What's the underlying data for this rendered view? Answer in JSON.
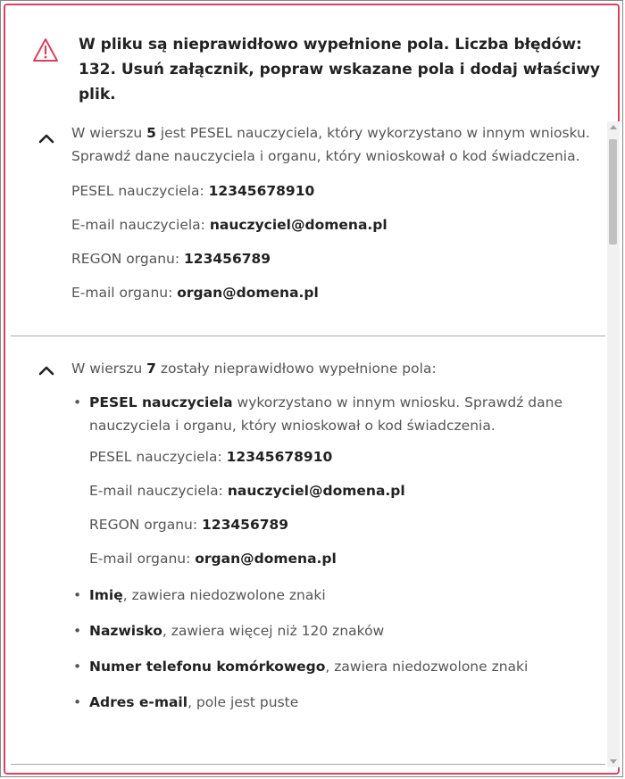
{
  "header": {
    "message": "W pliku są nieprawidłowo wypełnione pola. Liczba błędów: 132. Usuń załącznik, popraw wskazane pola i dodaj właściwy plik."
  },
  "sections": [
    {
      "intro_before": "W wierszu ",
      "row_number": "5",
      "intro_after": " jest PESEL nauczyciela, który wykorzystano w innym wniosku. Sprawdź dane nauczyciela i organu, który wnioskował o kod świadczenia.",
      "fields": [
        {
          "label": "PESEL nauczyciela: ",
          "value": "12345678910"
        },
        {
          "label": "E-mail nauczyciela: ",
          "value": "nauczyciel@domena.pl"
        },
        {
          "label": "REGON organu: ",
          "value": "123456789"
        },
        {
          "label": "E-mail organu: ",
          "value": "organ@domena.pl"
        }
      ]
    },
    {
      "intro_before": "W wierszu ",
      "row_number": "7",
      "intro_after": " zostały nieprawidłowo wypełnione pola:",
      "bullets": [
        {
          "strong": "PESEL nauczyciela",
          "text": " wykorzystano w innym wniosku. Sprawdź dane nauczyciela i organu, który wnioskował o kod świadczenia."
        },
        {
          "strong": "Imię",
          "text": ", zawiera niedozwolone znaki"
        },
        {
          "strong": "Nazwisko",
          "text": ", zawiera więcej niż 120 znaków"
        },
        {
          "strong": "Numer telefonu komórkowego",
          "text": ", zawiera niedozwolone znaki"
        },
        {
          "strong": "Adres e-mail",
          "text": ", pole jest puste"
        }
      ],
      "fields": [
        {
          "label": "PESEL nauczyciela: ",
          "value": "12345678910"
        },
        {
          "label": "E-mail nauczyciela: ",
          "value": "nauczyciel@domena.pl"
        },
        {
          "label": "REGON organu: ",
          "value": "123456789"
        },
        {
          "label": "E-mail organu: ",
          "value": "organ@domena.pl"
        }
      ]
    }
  ],
  "colors": {
    "border": "#d9415f",
    "warning": "#d9415f"
  },
  "icons": {
    "header": "warning-triangle-icon",
    "toggle": "chevron-up-icon"
  }
}
